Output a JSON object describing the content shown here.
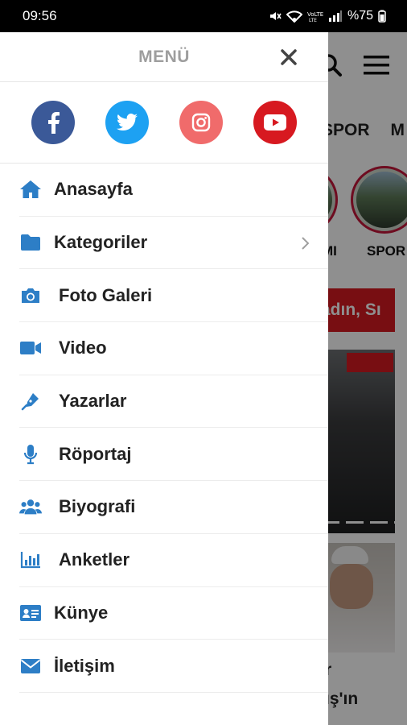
{
  "status_bar": {
    "time": "09:56",
    "battery": "%75"
  },
  "drawer": {
    "title": "MENÜ",
    "items": [
      {
        "label": "Anasayfa",
        "icon": "home-icon"
      },
      {
        "label": "Kategoriler",
        "icon": "folder-icon",
        "has_submenu": true
      },
      {
        "label": "Foto Galeri",
        "icon": "camera-icon"
      },
      {
        "label": "Video",
        "icon": "video-icon"
      },
      {
        "label": "Yazarlar",
        "icon": "pen-icon"
      },
      {
        "label": "Röportaj",
        "icon": "microphone-icon"
      },
      {
        "label": "Biyografi",
        "icon": "users-icon"
      },
      {
        "label": "Anketler",
        "icon": "chart-icon"
      },
      {
        "label": "Künye",
        "icon": "id-card-icon"
      },
      {
        "label": "İletişim",
        "icon": "envelope-icon"
      }
    ]
  },
  "socials": [
    {
      "name": "facebook",
      "color": "#3b5998"
    },
    {
      "name": "twitter",
      "color": "#1da1f2"
    },
    {
      "name": "instagram",
      "color": "#f06b6b"
    },
    {
      "name": "youtube",
      "color": "#d71920"
    }
  ],
  "background": {
    "tabs": [
      "SPOR",
      "M"
    ],
    "story_labels": [
      "MI",
      "SPOR"
    ],
    "headline_fragment": "adın, Sı",
    "news_fragment_1": "r",
    "news_fragment_2": "ış'ın"
  },
  "colors": {
    "icon": "#2d7ec6",
    "title": "#9e9e9e",
    "accent_red": "#d71920"
  }
}
